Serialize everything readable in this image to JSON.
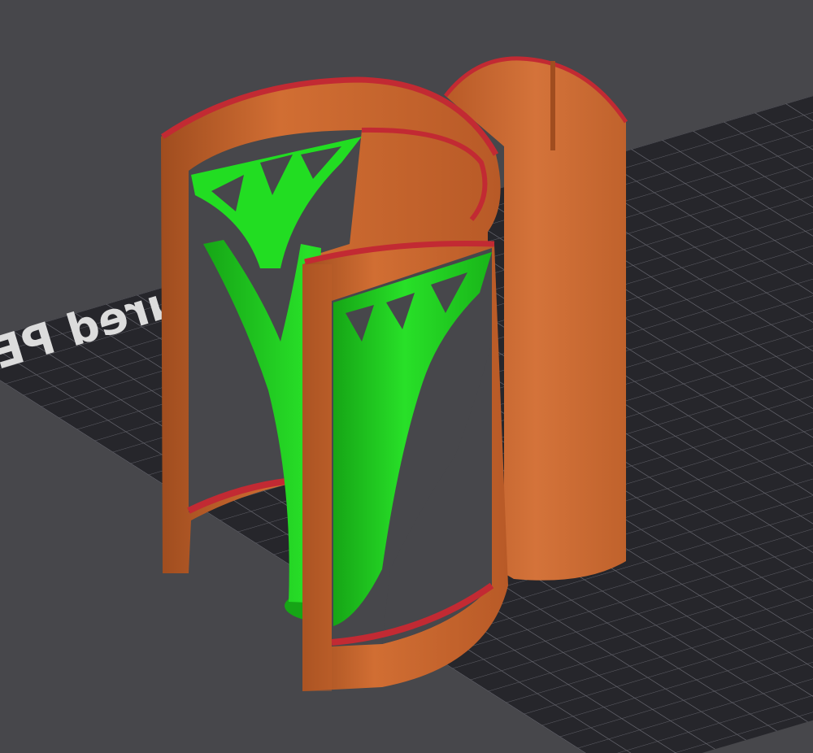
{
  "viewport": {
    "bed_label": "Textured PEI plate"
  },
  "colors": {
    "background": "#47474b",
    "bed_fill": "#26262b",
    "bed_grid": "#62626a",
    "bed_label": "#dcdcdc",
    "wall_light": "#d16e33",
    "wall_mid": "#c4622a",
    "wall_dark": "#a04d1f",
    "wall_top_edge": "#c22a33",
    "support_green": "#22dd22",
    "support_dark": "#16a516"
  },
  "icons": {
    "bed": "build-plate-grid",
    "support": "tree-support"
  }
}
